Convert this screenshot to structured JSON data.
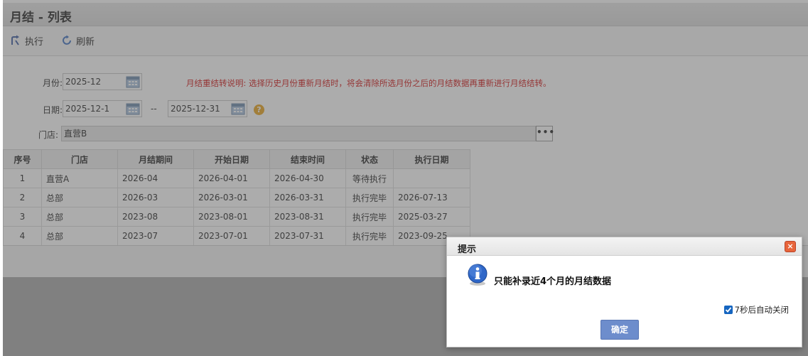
{
  "page": {
    "title": "月结 - 列表"
  },
  "toolbar": {
    "execute_label": "执行",
    "refresh_label": "刷新"
  },
  "form": {
    "month_label": "月份:",
    "month_value": "2025-12",
    "note": "月结重结转说明: 选择历史月份重新月结时，将会清除所选月份之后的月结数据再重新进行月结结转。",
    "date_label": "日期:",
    "date_start": "2025-12-1",
    "range_sep": "--",
    "date_end": "2025-12-31",
    "help_glyph": "?",
    "store_label": "门店:",
    "store_value": "直营B",
    "store_button": "•••"
  },
  "table": {
    "headers": [
      "序号",
      "门店",
      "月结期间",
      "开始日期",
      "结束时间",
      "状态",
      "执行日期"
    ],
    "rows": [
      [
        "1",
        "直营A",
        "2026-04",
        "2026-04-01",
        "2026-04-30",
        "等待执行",
        ""
      ],
      [
        "2",
        "总部",
        "2026-03",
        "2026-03-01",
        "2026-03-31",
        "执行完毕",
        "2026-07-13"
      ],
      [
        "3",
        "总部",
        "2023-08",
        "2023-08-01",
        "2023-08-31",
        "执行完毕",
        "2025-03-27"
      ],
      [
        "4",
        "总部",
        "2023-07",
        "2023-07-01",
        "2023-07-31",
        "执行完毕",
        "2023-09-25"
      ]
    ]
  },
  "dialog": {
    "title": "提示",
    "close_glyph": "×",
    "message": "只能补录近4个月的月结数据",
    "auto_close_label": "7秒后自动关闭",
    "auto_close_checked": true,
    "ok_label": "确定"
  },
  "colors": {
    "accent": "#6d8dcc",
    "note_red": "#d01010",
    "help_orange": "#e8a21a",
    "close_orange": "#e8643a"
  }
}
